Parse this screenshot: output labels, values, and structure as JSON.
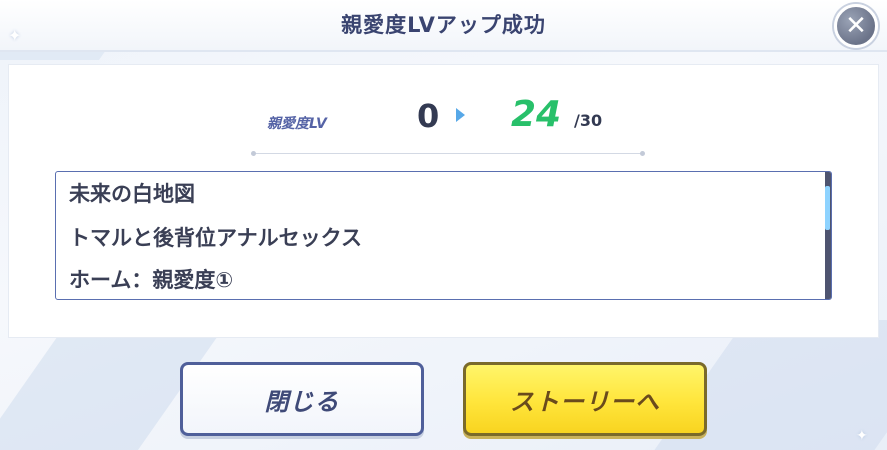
{
  "dialog": {
    "title": "親愛度LVアップ成功",
    "close_icon_glyph": "✕"
  },
  "level": {
    "label": "親愛度LV",
    "from": "0",
    "to": "24",
    "max": "/30"
  },
  "unlocked_list": {
    "items": [
      "未来の白地図",
      "トマルと後背位アナルセックス",
      "ホーム：親愛度①"
    ]
  },
  "buttons": {
    "close_label": "閉じる",
    "story_label": "ストーリーへ"
  },
  "colors": {
    "accent_green": "#28c06a",
    "title_navy": "#3a4470",
    "story_button_yellow": "#ffe53b"
  }
}
